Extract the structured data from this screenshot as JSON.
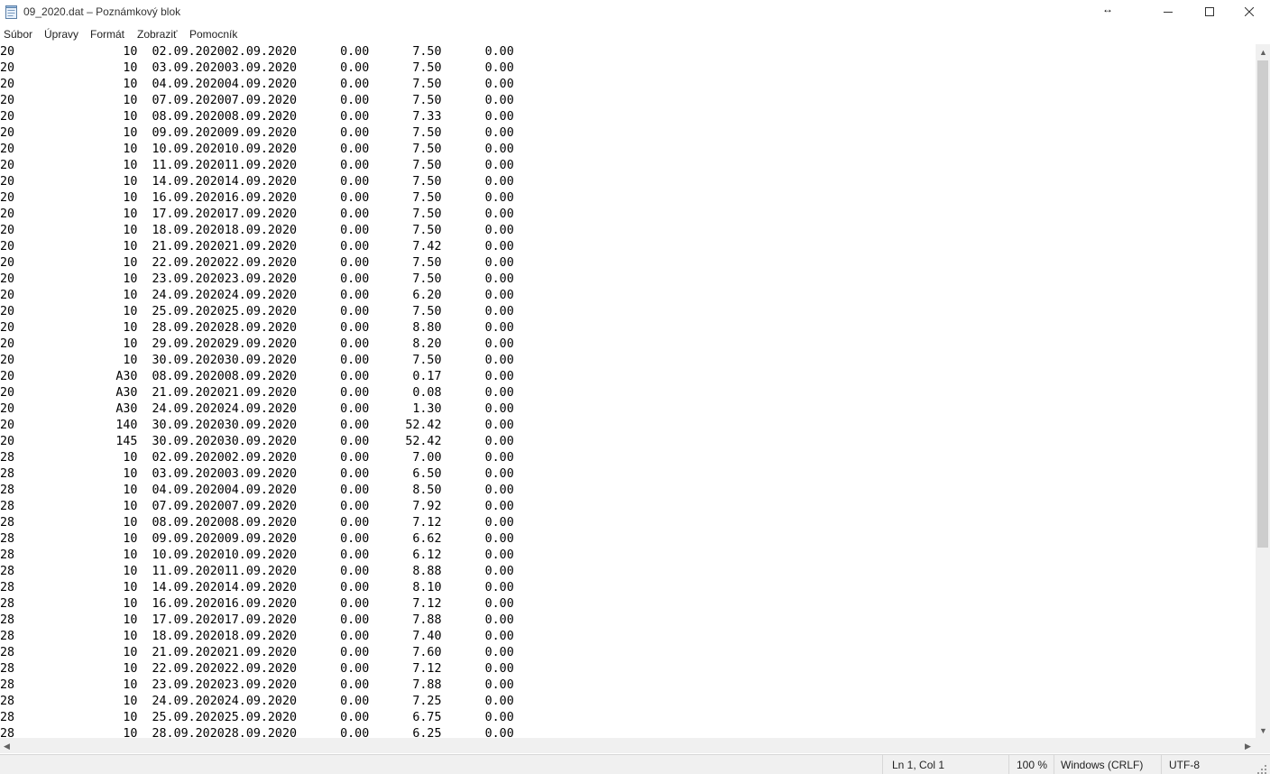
{
  "window": {
    "title": "09_2020.dat – Poznámkový blok",
    "icon": "notepad-icon",
    "controls": [
      "minimize-icon",
      "maximize-icon",
      "close-icon"
    ]
  },
  "menu": [
    "Súbor",
    "Úpravy",
    "Formát",
    "Zobraziť",
    "Pomocník"
  ],
  "editor": {
    "lines": [
      "20               10  02.09.202002.09.2020      0.00      7.50      0.00",
      "20               10  03.09.202003.09.2020      0.00      7.50      0.00",
      "20               10  04.09.202004.09.2020      0.00      7.50      0.00",
      "20               10  07.09.202007.09.2020      0.00      7.50      0.00",
      "20               10  08.09.202008.09.2020      0.00      7.33      0.00",
      "20               10  09.09.202009.09.2020      0.00      7.50      0.00",
      "20               10  10.09.202010.09.2020      0.00      7.50      0.00",
      "20               10  11.09.202011.09.2020      0.00      7.50      0.00",
      "20               10  14.09.202014.09.2020      0.00      7.50      0.00",
      "20               10  16.09.202016.09.2020      0.00      7.50      0.00",
      "20               10  17.09.202017.09.2020      0.00      7.50      0.00",
      "20               10  18.09.202018.09.2020      0.00      7.50      0.00",
      "20               10  21.09.202021.09.2020      0.00      7.42      0.00",
      "20               10  22.09.202022.09.2020      0.00      7.50      0.00",
      "20               10  23.09.202023.09.2020      0.00      7.50      0.00",
      "20               10  24.09.202024.09.2020      0.00      6.20      0.00",
      "20               10  25.09.202025.09.2020      0.00      7.50      0.00",
      "20               10  28.09.202028.09.2020      0.00      8.80      0.00",
      "20               10  29.09.202029.09.2020      0.00      8.20      0.00",
      "20               10  30.09.202030.09.2020      0.00      7.50      0.00",
      "20              A30  08.09.202008.09.2020      0.00      0.17      0.00",
      "20              A30  21.09.202021.09.2020      0.00      0.08      0.00",
      "20              A30  24.09.202024.09.2020      0.00      1.30      0.00",
      "20              140  30.09.202030.09.2020      0.00     52.42      0.00",
      "20              145  30.09.202030.09.2020      0.00     52.42      0.00",
      "28               10  02.09.202002.09.2020      0.00      7.00      0.00",
      "28               10  03.09.202003.09.2020      0.00      6.50      0.00",
      "28               10  04.09.202004.09.2020      0.00      8.50      0.00",
      "28               10  07.09.202007.09.2020      0.00      7.92      0.00",
      "28               10  08.09.202008.09.2020      0.00      7.12      0.00",
      "28               10  09.09.202009.09.2020      0.00      6.62      0.00",
      "28               10  10.09.202010.09.2020      0.00      6.12      0.00",
      "28               10  11.09.202011.09.2020      0.00      8.88      0.00",
      "28               10  14.09.202014.09.2020      0.00      8.10      0.00",
      "28               10  16.09.202016.09.2020      0.00      7.12      0.00",
      "28               10  17.09.202017.09.2020      0.00      7.88      0.00",
      "28               10  18.09.202018.09.2020      0.00      7.40      0.00",
      "28               10  21.09.202021.09.2020      0.00      7.60      0.00",
      "28               10  22.09.202022.09.2020      0.00      7.12      0.00",
      "28               10  23.09.202023.09.2020      0.00      7.88      0.00",
      "28               10  24.09.202024.09.2020      0.00      7.25      0.00",
      "28               10  25.09.202025.09.2020      0.00      6.75      0.00",
      "28               10  28.09.202028.09.2020      0.00      6.25      0.00"
    ]
  },
  "status": {
    "position": "Ln 1, Col 1",
    "zoom": "100 %",
    "line_ending": "Windows (CRLF)",
    "encoding": "UTF-8"
  }
}
